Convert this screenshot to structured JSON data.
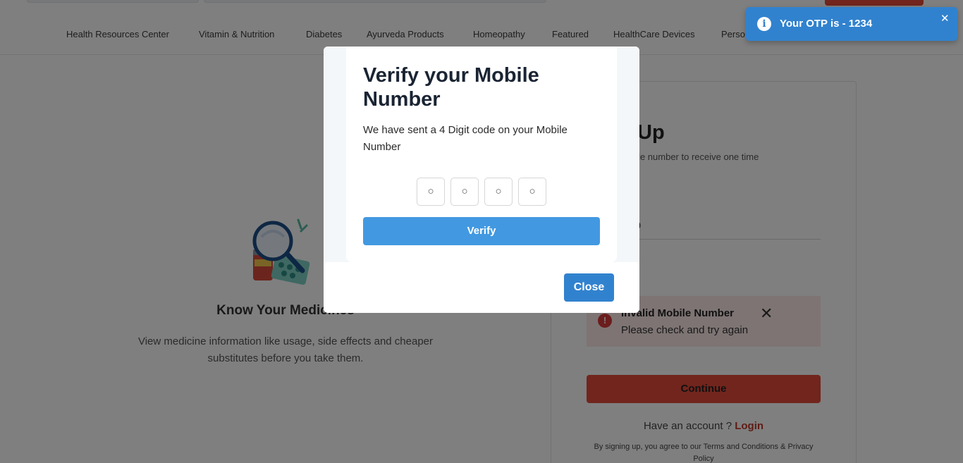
{
  "nav": {
    "items": [
      "Health Resources Center",
      "Vitamin & Nutrition",
      "Diabetes",
      "Ayurveda Products",
      "Homeopathy",
      "Featured",
      "HealthCare Devices",
      "Perso"
    ]
  },
  "left": {
    "title": "Know Your Medicines",
    "description": "View medicine information like usage, side effects and cheaper substitutes before you take them."
  },
  "signup": {
    "title": "Up",
    "subtitle": "your mobile number to receive one time\nOTP)",
    "mobile_value": "234567889",
    "error_title": "Invalid Mobile Number",
    "error_message": "Please check and try again",
    "continue_label": "Continue",
    "have_account": "Have an account ? ",
    "login_label": "Login",
    "terms": "By signing up, you agree to our Terms and Conditions & Privacy Policy"
  },
  "modal": {
    "title": "Verify your Mobile Number",
    "description": "We have sent a 4 Digit code on your Mobile Number",
    "otp_placeholder": "○",
    "verify_label": "Verify",
    "close_label": "Close"
  },
  "toast": {
    "message": "Your OTP is - 1234"
  },
  "colors": {
    "primary_blue": "#3182ce",
    "verify_blue": "#4299e1",
    "brand_red": "#e24b3b",
    "error_bg": "#fde8e8"
  }
}
